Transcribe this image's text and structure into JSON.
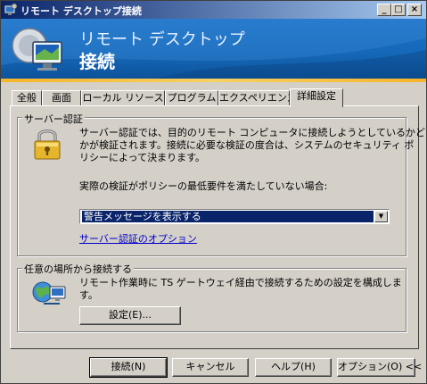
{
  "window": {
    "title": "リモート デスクトップ接続",
    "minimize": "_",
    "maximize": "□",
    "close": "×"
  },
  "banner": {
    "subtitle": "リモート デスクトップ",
    "title": "接続"
  },
  "tabs": [
    {
      "label": "全般"
    },
    {
      "label": "画面"
    },
    {
      "label": "ローカル リソース"
    },
    {
      "label": "プログラム"
    },
    {
      "label": "エクスペリエンス"
    },
    {
      "label": "詳細設定"
    }
  ],
  "server_auth": {
    "group_label": "サーバー認証",
    "description_line1": "サーバー認証では、目的のリモート コンピュータに接続しようとしているかどう",
    "description_line2": "かが検証されます。接続に必要な検証の度合は、システムのセキュリティ ポ",
    "description_line3": "リシーによって決まります。",
    "prompt": "実際の検証がポリシーの最低要件を満たしていない場合:",
    "selected_option": "警告メッセージを表示する",
    "options_link": "サーバー認証のオプション"
  },
  "connect_anywhere": {
    "group_label": "任意の場所から接続する",
    "description_line1": "リモート作業時に TS ゲートウェイ経由で接続するための設定を構成しま",
    "description_line2": "す。",
    "settings_button": "設定(E)..."
  },
  "footer": {
    "connect_button": "接続(N)",
    "cancel_button": "キャンセル",
    "help_button": "ヘルプ(H)",
    "options_button": "オプション(O) <<"
  }
}
